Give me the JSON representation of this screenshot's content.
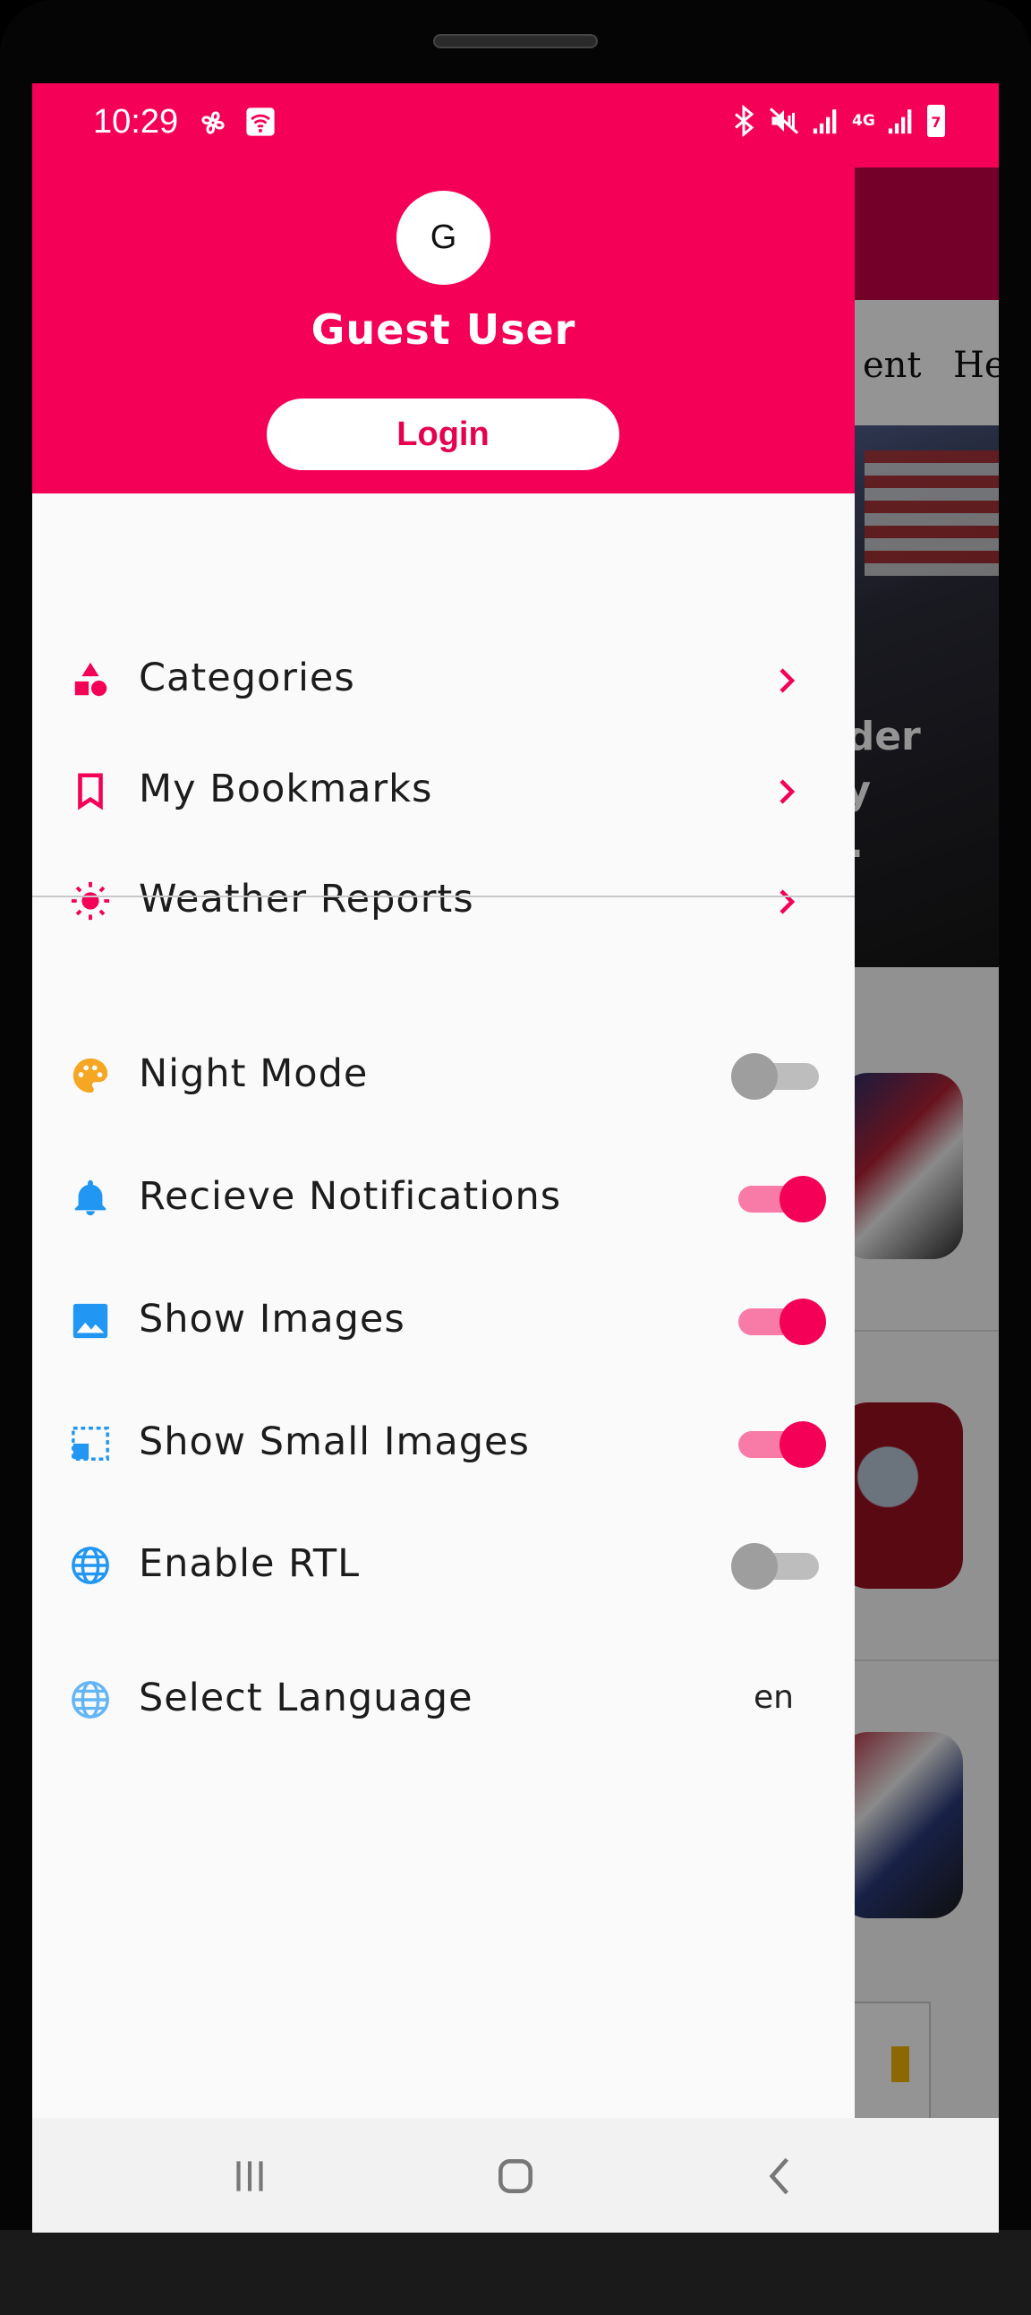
{
  "status_bar": {
    "time": "10:29",
    "network_type": "4G",
    "battery_level": "7"
  },
  "background_app": {
    "tabs": [
      "ent",
      "He"
    ],
    "hero_text_lines": [
      "ader",
      "ay",
      "C."
    ]
  },
  "drawer": {
    "avatar_initial": "G",
    "user_name": "Guest User",
    "login_label": "Login",
    "menu_items": [
      {
        "label": "Categories",
        "icon": "categories-icon"
      },
      {
        "label": "My Bookmarks",
        "icon": "bookmark-icon"
      },
      {
        "label": "Weather Reports",
        "icon": "sun-icon"
      }
    ],
    "settings": [
      {
        "label": "Night Mode",
        "icon": "palette-icon",
        "enabled": false
      },
      {
        "label": "Recieve Notifications",
        "icon": "bell-icon",
        "enabled": true
      },
      {
        "label": "Show Images",
        "icon": "image-icon",
        "enabled": true
      },
      {
        "label": "Show Small Images",
        "icon": "small-image-icon",
        "enabled": true
      },
      {
        "label": "Enable RTL",
        "icon": "globe-icon",
        "enabled": false
      }
    ],
    "language": {
      "label": "Select Language",
      "icon": "globe-icon",
      "value": "en"
    }
  },
  "colors": {
    "accent": "#f50057",
    "appbar_dim": "#c80047",
    "switch_track_on": "#f77ba6",
    "switch_off": "#9e9e9e",
    "palette_icon": "#f5a623",
    "blue_icon": "#2196f3"
  },
  "navigation_bar": {
    "buttons": [
      "recent-apps-icon",
      "home-icon",
      "back-icon"
    ]
  }
}
